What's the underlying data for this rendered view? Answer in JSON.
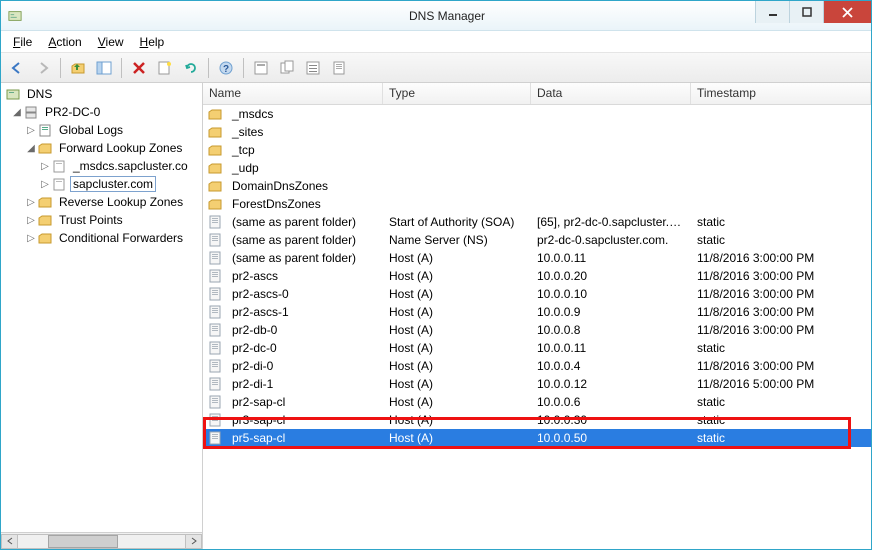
{
  "window": {
    "title": "DNS Manager"
  },
  "menu": {
    "file": "File",
    "action": "Action",
    "view": "View",
    "help": "Help"
  },
  "tree": {
    "root": "DNS",
    "server": "PR2-DC-0",
    "globalLogs": "Global Logs",
    "fwdZones": "Forward Lookup Zones",
    "zone1": "_msdcs.sapcluster.co",
    "zone2": "sapcluster.com",
    "revZones": "Reverse Lookup Zones",
    "trustPoints": "Trust Points",
    "condFwd": "Conditional Forwarders"
  },
  "columns": {
    "name": "Name",
    "type": "Type",
    "data": "Data",
    "timestamp": "Timestamp"
  },
  "colWidths": {
    "name": 180,
    "type": 148,
    "data": 160,
    "timestamp": 160
  },
  "folders": [
    "_msdcs",
    "_sites",
    "_tcp",
    "_udp",
    "DomainDnsZones",
    "ForestDnsZones"
  ],
  "records": [
    {
      "name": "(same as parent folder)",
      "type": "Start of Authority (SOA)",
      "data": "[65], pr2-dc-0.sapcluster.c...",
      "ts": "static"
    },
    {
      "name": "(same as parent folder)",
      "type": "Name Server (NS)",
      "data": "pr2-dc-0.sapcluster.com.",
      "ts": "static"
    },
    {
      "name": "(same as parent folder)",
      "type": "Host (A)",
      "data": "10.0.0.11",
      "ts": "11/8/2016 3:00:00 PM"
    },
    {
      "name": "pr2-ascs",
      "type": "Host (A)",
      "data": "10.0.0.20",
      "ts": "11/8/2016 3:00:00 PM"
    },
    {
      "name": "pr2-ascs-0",
      "type": "Host (A)",
      "data": "10.0.0.10",
      "ts": "11/8/2016 3:00:00 PM"
    },
    {
      "name": "pr2-ascs-1",
      "type": "Host (A)",
      "data": "10.0.0.9",
      "ts": "11/8/2016 3:00:00 PM"
    },
    {
      "name": "pr2-db-0",
      "type": "Host (A)",
      "data": "10.0.0.8",
      "ts": "11/8/2016 3:00:00 PM"
    },
    {
      "name": "pr2-dc-0",
      "type": "Host (A)",
      "data": "10.0.0.11",
      "ts": "static"
    },
    {
      "name": "pr2-di-0",
      "type": "Host (A)",
      "data": "10.0.0.4",
      "ts": "11/8/2016 3:00:00 PM"
    },
    {
      "name": "pr2-di-1",
      "type": "Host (A)",
      "data": "10.0.0.12",
      "ts": "11/8/2016 5:00:00 PM"
    },
    {
      "name": "pr2-sap-cl",
      "type": "Host (A)",
      "data": "10.0.0.6",
      "ts": "static"
    },
    {
      "name": "pr3-sap-cl",
      "type": "Host (A)",
      "data": "10.0.0.30",
      "ts": "static"
    },
    {
      "name": "pr5-sap-cl",
      "type": "Host (A)",
      "data": "10.0.0.50",
      "ts": "static",
      "selected": true
    }
  ]
}
